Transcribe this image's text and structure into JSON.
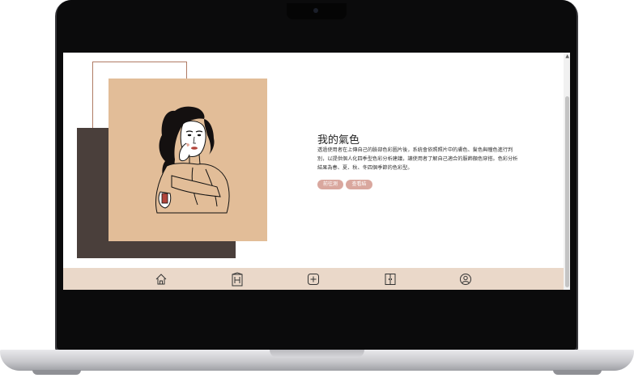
{
  "hero": {
    "title": "我的氣色",
    "description": "透過使用者在上傳自己的臉部色彩圖片後，系統會依照照片中的膚色、髮色與瞳色進行判別，以提供個人化四季型色彩分析建議，讓使用者了解自己適合的服飾顏色穿搭。色彩分析結果為春、夏、秋、冬四個季節的色彩型。",
    "buttons": {
      "test_label": "前往測驗",
      "result_label": "查看結果"
    }
  },
  "bottom_nav": {
    "items": [
      {
        "icon": "home-icon"
      },
      {
        "icon": "wardrobe-icon"
      },
      {
        "icon": "add-icon"
      },
      {
        "icon": "closet-icon"
      },
      {
        "icon": "profile-icon"
      }
    ]
  },
  "colors": {
    "accent_button": "#d9a79e",
    "beige_panel": "#e2bd98",
    "dark_panel": "#4a3f3b",
    "nav_bar": "#ead8c9"
  }
}
